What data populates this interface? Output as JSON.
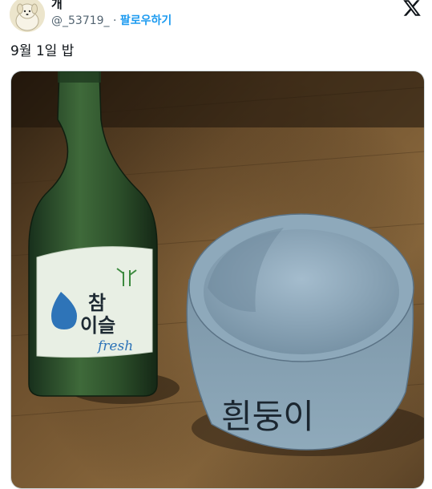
{
  "author": {
    "display_name": "개",
    "handle": "@_53719_",
    "separator": "·",
    "follow_label": "팔로우하기",
    "avatar_icon": "puppy-avatar-icon"
  },
  "platform": {
    "logo_icon": "x-logo-icon"
  },
  "tweet": {
    "text": "9월 1일 밥"
  },
  "photo": {
    "bottle_label": {
      "brand": "참이슬",
      "line1": "참",
      "line2": "이슬",
      "sub": "fresh"
    },
    "bowl_text": "흰둥이"
  },
  "colors": {
    "accent": "#1d9bf0",
    "text": "#0f1419",
    "muted": "#536471"
  }
}
